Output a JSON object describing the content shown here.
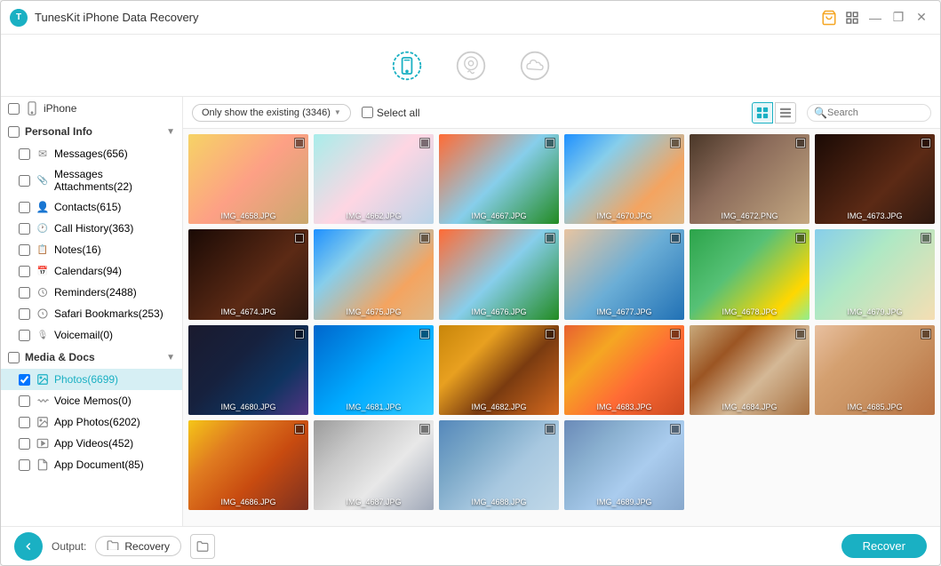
{
  "app": {
    "title": "TunesKit iPhone Data Recovery",
    "logo_text": "T"
  },
  "titlebar": {
    "cart_icon": "🛒",
    "grid_icon": "▦",
    "minimize": "—",
    "maximize": "❐",
    "close": "✕"
  },
  "toolbar": {
    "icon1_label": "recover-from-device",
    "icon2_label": "recover-from-itunes",
    "icon3_label": "recover-from-icloud"
  },
  "sidebar": {
    "iphone_label": "iPhone",
    "personal_info_label": "Personal Info",
    "items": [
      {
        "label": "Messages(656)",
        "icon": "✉",
        "id": "messages"
      },
      {
        "label": "Messages Attachments(22)",
        "icon": "📎",
        "id": "messages-attachments"
      },
      {
        "label": "Contacts(615)",
        "icon": "👤",
        "id": "contacts"
      },
      {
        "label": "Call History(363)",
        "icon": "🕐",
        "id": "call-history"
      },
      {
        "label": "Notes(16)",
        "icon": "📋",
        "id": "notes"
      },
      {
        "label": "Calendars(94)",
        "icon": "📅",
        "id": "calendars"
      },
      {
        "label": "Reminders(2488)",
        "icon": "🔔",
        "id": "reminders"
      },
      {
        "label": "Safari Bookmarks(253)",
        "icon": "◎",
        "id": "safari-bookmarks"
      },
      {
        "label": "Voicemail(0)",
        "icon": "🎤",
        "id": "voicemail"
      }
    ],
    "media_docs_label": "Media & Docs",
    "media_items": [
      {
        "label": "Photos(6699)",
        "icon": "📷",
        "id": "photos",
        "active": true
      },
      {
        "label": "Voice Memos(0)",
        "icon": "🎵",
        "id": "voice-memos"
      },
      {
        "label": "App Photos(6202)",
        "icon": "🖼",
        "id": "app-photos"
      },
      {
        "label": "App Videos(452)",
        "icon": "🎬",
        "id": "app-videos"
      },
      {
        "label": "App Document(85)",
        "icon": "📄",
        "id": "app-document"
      }
    ]
  },
  "content_toolbar": {
    "filter_label": "Only show the existing (3346)",
    "select_all_label": "Select all",
    "grid_view_label": "⊞",
    "list_view_label": "≡",
    "search_placeholder": "Search"
  },
  "images": [
    {
      "id": 1,
      "label": "IMG_4658.JPG",
      "bg": "bg-dog"
    },
    {
      "id": 2,
      "label": "IMG_4662.JPG",
      "bg": "bg-landscape"
    },
    {
      "id": 3,
      "label": "IMG_4667.JPG",
      "bg": "bg-sunset-palm"
    },
    {
      "id": 4,
      "label": "IMG_4670.JPG",
      "bg": "bg-beach"
    },
    {
      "id": 5,
      "label": "IMG_4672.PNG",
      "bg": "bg-portrait-girl"
    },
    {
      "id": 6,
      "label": "IMG_4673.JPG",
      "bg": "bg-dark-room"
    },
    {
      "id": 7,
      "label": "IMG_4674.JPG",
      "bg": "bg-dark-room"
    },
    {
      "id": 8,
      "label": "IMG_4675.JPG",
      "bg": "bg-beach"
    },
    {
      "id": 9,
      "label": "IMG_4676.JPG",
      "bg": "bg-sunset-palm"
    },
    {
      "id": 10,
      "label": "IMG_4677.JPG",
      "bg": "bg-sunglasses"
    },
    {
      "id": 11,
      "label": "IMG_4678.JPG",
      "bg": "bg-pineapple"
    },
    {
      "id": 12,
      "label": "IMG_4679.JPG",
      "bg": "bg-sitting-girl"
    },
    {
      "id": 13,
      "label": "IMG_4680.JPG",
      "bg": "bg-mountain-road"
    },
    {
      "id": 14,
      "label": "IMG_4681.JPG",
      "bg": "bg-blue-ocean"
    },
    {
      "id": 15,
      "label": "IMG_4682.JPG",
      "bg": "bg-autumn-road"
    },
    {
      "id": 16,
      "label": "IMG_4683.JPG",
      "bg": "bg-orange-sunset"
    },
    {
      "id": 17,
      "label": "IMG_4684.JPG",
      "bg": "bg-old-town"
    },
    {
      "id": 18,
      "label": "IMG_4685.JPG",
      "bg": "bg-colorful-city"
    },
    {
      "id": 19,
      "label": "IMG_4686.JPG",
      "bg": "bg-drinks"
    },
    {
      "id": 20,
      "label": "IMG_4687.JPG",
      "bg": "bg-building"
    },
    {
      "id": 21,
      "label": "IMG_4688.JPG",
      "bg": "bg-city-scene"
    },
    {
      "id": 22,
      "label": "IMG_4689.JPG",
      "bg": "bg-prague"
    }
  ],
  "footer": {
    "output_label": "Output:",
    "output_path": "Recovery",
    "recover_button_label": "Recover",
    "back_arrow": "←"
  }
}
